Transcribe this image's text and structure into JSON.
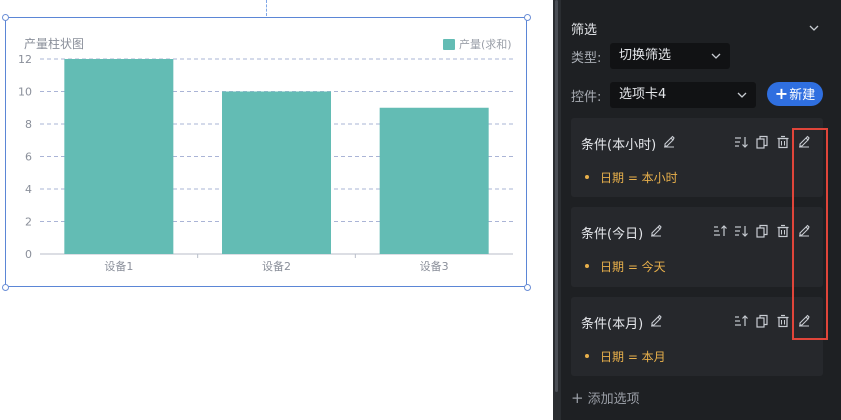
{
  "chart": {
    "title": "产量柱状图",
    "legend_label": "产量(求和)",
    "bar_color": "#63bcb4"
  },
  "chart_data": {
    "type": "bar",
    "title": "产量柱状图",
    "categories": [
      "设备1",
      "设备2",
      "设备3"
    ],
    "series": [
      {
        "name": "产量(求和)",
        "values": [
          12,
          10,
          9
        ]
      }
    ],
    "yticks": [
      "0",
      "2",
      "4",
      "6",
      "8",
      "10",
      "12"
    ],
    "ylim": [
      0,
      12
    ],
    "grid": true,
    "legend_position": "top-right"
  },
  "panel": {
    "title": "筛选",
    "type_label": "类型:",
    "type_value": "切换筛选",
    "control_label": "控件:",
    "control_value": "选项卡4",
    "new_button": "新建",
    "add_option": "添加选项",
    "conditions": [
      {
        "title": "条件(本小时)",
        "text": "日期 = 本小时"
      },
      {
        "title": "条件(今日)",
        "text": "日期 = 今天"
      },
      {
        "title": "条件(本月)",
        "text": "日期 = 本月"
      }
    ]
  },
  "colors": {
    "accent": "#2f6fe0",
    "condition_text": "#e8b04b",
    "highlight": "#e0453a"
  }
}
